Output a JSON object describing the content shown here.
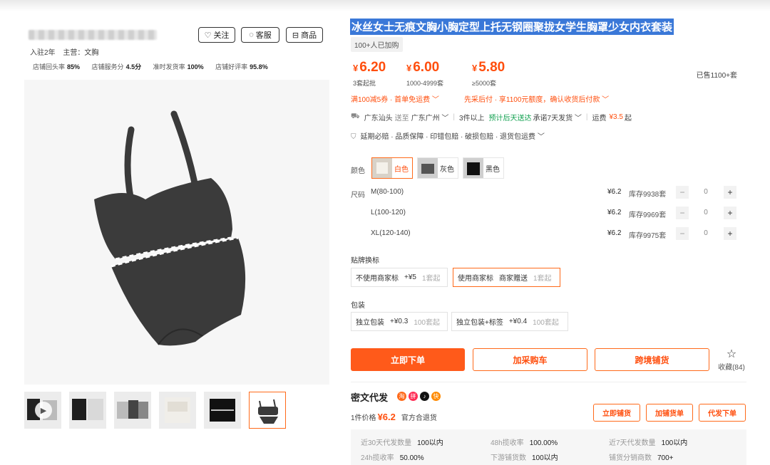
{
  "shop": {
    "follow_label": "关注",
    "service_label": "客服",
    "goods_label": "商品",
    "years": "入驻2年",
    "main_business": "主营：文胸",
    "scores": [
      {
        "label": "店铺回头率",
        "value": "85%"
      },
      {
        "label": "店铺服务分",
        "value": "4.5分"
      },
      {
        "label": "准时发货率",
        "value": "100%"
      },
      {
        "label": "店铺好评率",
        "value": "95.8%"
      }
    ]
  },
  "product": {
    "title": "冰丝女士无痕文胸小胸定型上托无钢圈聚拢女学生胸罩少女内衣套装",
    "buyers": "100+人已加购",
    "sold": "已售1100+套",
    "prices": [
      {
        "yen": "¥",
        "value": "6.20",
        "note": "3套起批"
      },
      {
        "yen": "¥",
        "value": "6.00",
        "note": "1000-4999套"
      },
      {
        "yen": "¥",
        "value": "5.80",
        "note": "≥5000套"
      }
    ],
    "promo_left": "满100减5券 · 首单免运费 ﹀",
    "promo_right": "先采后付 · 享1100元额度，确认收货后付款 ﹀",
    "shipping": {
      "from": "广东汕头",
      "to_label": "送至",
      "to": "广东广州 ﹀",
      "qty": "3件以上",
      "eta": "预计后天送达",
      "promise": "承诺7天发货 ﹀",
      "fee_label": "运费",
      "fee": "¥3.5",
      "fee_suffix": "起"
    },
    "guarantee": "延期必赔 · 品质保障 · 印错包赔 · 破损包赔 · 退货包运费 ﹀"
  },
  "colors": {
    "label": "颜色",
    "options": [
      {
        "name": "白色"
      },
      {
        "name": "灰色"
      },
      {
        "name": "黑色"
      }
    ]
  },
  "sizes": {
    "label": "尺码",
    "rows": [
      {
        "name": "M(80-100)",
        "price": "¥6.2",
        "stock": "库存9938套",
        "qty": "0"
      },
      {
        "name": "L(100-120)",
        "price": "¥6.2",
        "stock": "库存9969套",
        "qty": "0"
      },
      {
        "name": "XL(120-140)",
        "price": "¥6.2",
        "stock": "库存9975套",
        "qty": "0"
      }
    ]
  },
  "label_swap": {
    "label": "贴牌换标",
    "options": [
      {
        "name": "不使用商家标",
        "extra": "+¥5",
        "min": "1套起"
      },
      {
        "name": "使用商家标",
        "extra": "商家赠送",
        "min": "1套起"
      }
    ]
  },
  "packaging": {
    "label": "包装",
    "options": [
      {
        "name": "独立包装",
        "extra": "+¥0.3",
        "min": "100套起"
      },
      {
        "name": "独立包装+标签",
        "extra": "+¥0.4",
        "min": "100套起"
      }
    ]
  },
  "actions": {
    "buy_now": "立即下单",
    "add_cart": "加采购车",
    "cross_border": "跨境铺货",
    "favorite": "收藏",
    "favorite_count": "(84)"
  },
  "dropship": {
    "title": "密文代发",
    "unit_label": "1件价格",
    "unit_price": "¥6.2",
    "return_note": "官方合退货",
    "btn_list_now": "立即铺货",
    "btn_add_list": "加铺货单",
    "btn_dropship": "代发下单",
    "stats": [
      {
        "k": "近30天代发数量",
        "v": "100以内"
      },
      {
        "k": "48h揽收率",
        "v": "100.00%"
      },
      {
        "k": "近7天代发数量",
        "v": "100以内"
      },
      {
        "k": "24h揽收率",
        "v": "50.00%"
      },
      {
        "k": "下游铺货数",
        "v": "100以内"
      },
      {
        "k": "铺货分销商数",
        "v": "700+"
      }
    ]
  },
  "colors_theme": {
    "accent": "#ff5a1a",
    "price": "#ff4e0d",
    "highlight": "#3a78d8"
  }
}
